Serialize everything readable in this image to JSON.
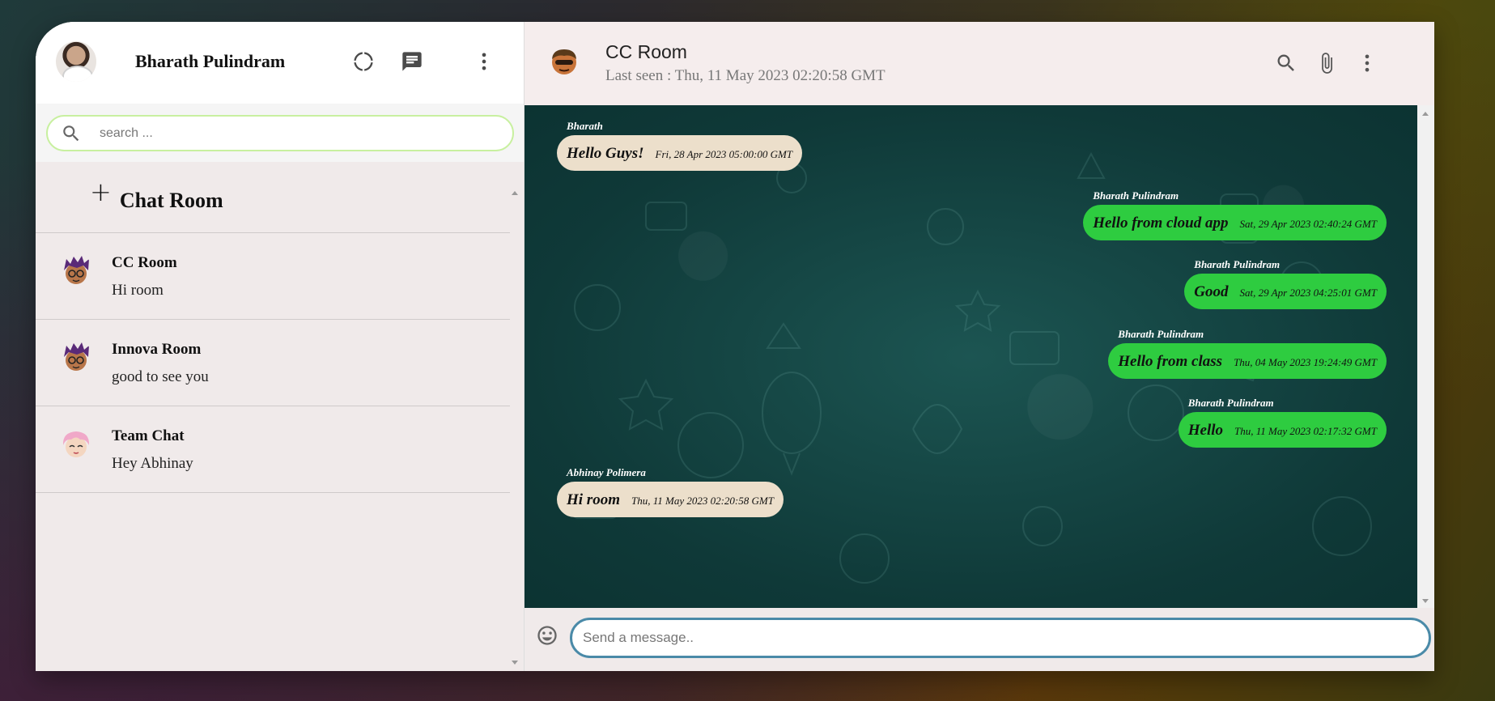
{
  "sidebar": {
    "user_name": "Bharath Pulindram",
    "search_placeholder": "search ...",
    "new_room_plus": "+",
    "new_room_label": "Chat Room",
    "rooms": [
      {
        "name": "CC Room",
        "last": "Hi room",
        "avatar": "purple-hair-avatar"
      },
      {
        "name": "Innova Room",
        "last": "good to see you",
        "avatar": "purple-hair-avatar"
      },
      {
        "name": "Team Chat",
        "last": "Hey Abhinay",
        "avatar": "pink-hair-avatar"
      }
    ]
  },
  "chat": {
    "title": "CC Room",
    "last_seen": "Last seen : Thu, 11 May 2023 02:20:58 GMT",
    "composer_placeholder": "Send a message..",
    "messages": [
      {
        "sender": "Bharath",
        "text": "Hello Guys!",
        "time": "Fri, 28 Apr 2023 05:00:00 GMT",
        "side": "in"
      },
      {
        "sender": "Bharath Pulindram",
        "text": "Hello from cloud app",
        "time": "Sat, 29 Apr 2023 02:40:24 GMT",
        "side": "out"
      },
      {
        "sender": "Bharath Pulindram",
        "text": "Good",
        "time": "Sat, 29 Apr 2023 04:25:01 GMT",
        "side": "out"
      },
      {
        "sender": "Bharath Pulindram",
        "text": "Hello from class",
        "time": "Thu, 04 May 2023 19:24:49 GMT",
        "side": "out"
      },
      {
        "sender": "Bharath Pulindram",
        "text": "Hello",
        "time": "Thu, 11 May 2023 02:17:32 GMT",
        "side": "out"
      },
      {
        "sender": "Abhinay Polimera",
        "text": "Hi room",
        "time": "Thu, 11 May 2023 02:20:58 GMT",
        "side": "in"
      }
    ]
  },
  "colors": {
    "incoming_bubble": "#ecdfcb",
    "outgoing_bubble": "#2ecc40",
    "chat_background": "#10403e",
    "search_border": "#c8f0a0",
    "composer_border": "#4a8aa8"
  },
  "icons": {
    "sidebar_header": [
      "status-icon",
      "chat-icon",
      "more-vert-icon"
    ],
    "chat_header": [
      "search-icon",
      "attach-icon",
      "more-vert-icon"
    ],
    "composer": "emoji-icon"
  }
}
